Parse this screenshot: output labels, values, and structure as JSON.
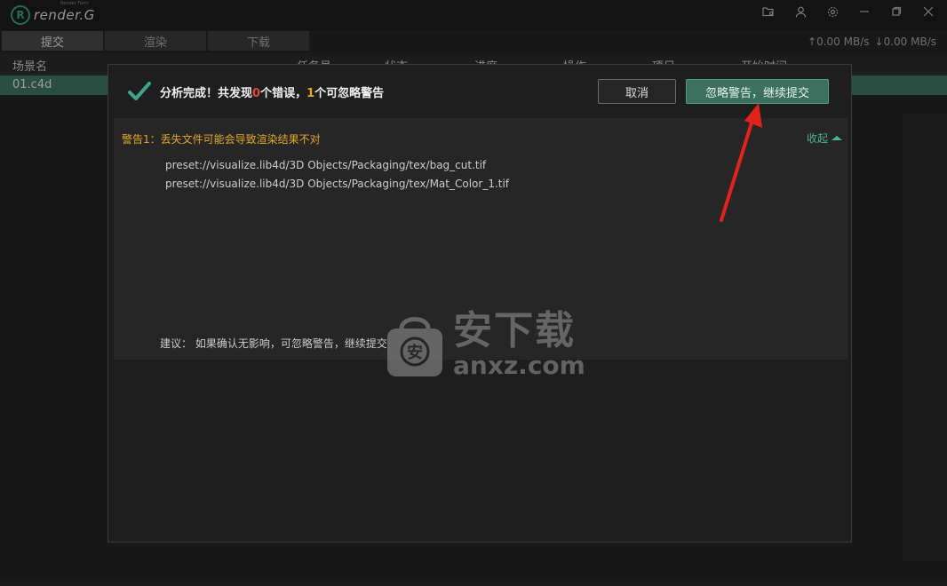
{
  "app": {
    "logo_letter": "R",
    "logo_name": "render.G",
    "logo_sub": "Render Farm"
  },
  "titlebar_icons": [
    "folder-settings-icon",
    "user-icon",
    "gear-icon",
    "minimize-icon",
    "maximize-icon",
    "close-icon"
  ],
  "tabs": [
    {
      "label": "提交",
      "active": true
    },
    {
      "label": "渲染",
      "active": false
    },
    {
      "label": "下载",
      "active": false
    }
  ],
  "speed": {
    "upload": "0.00 MB/s",
    "download": "0.00 MB/s"
  },
  "table": {
    "headers": [
      "场景名",
      "任务号",
      "状态",
      "进度",
      "操作",
      "项目",
      "开始时间"
    ],
    "rows": [
      {
        "scene": "01.c4d"
      }
    ]
  },
  "dialog": {
    "title_prefix": "分析完成！共发现",
    "error_count": "0",
    "title_mid": "个错误，",
    "warning_count": "1",
    "title_suffix": "个可忽略警告",
    "cancel_label": "取消",
    "ignore_label": "忽略警告，继续提交",
    "warning_title": "警告1：丢失文件可能会导致渲染结果不对",
    "collapse_label": "收起",
    "files": [
      "preset://visualize.lib4d/3D Objects/Packaging/tex/bag_cut.tif",
      "preset://visualize.lib4d/3D Objects/Packaging/tex/Mat_Color_1.tif"
    ],
    "suggestion": "建议：  如果确认无影响，可忽略警告，继续提交"
  },
  "watermark": {
    "cn": "安下载",
    "en": "anxz.com",
    "bag_char": "安"
  },
  "colors": {
    "accent": "#3aa788",
    "error": "#e0463c",
    "warning": "#e8a623",
    "arrow": "#e0241c"
  }
}
